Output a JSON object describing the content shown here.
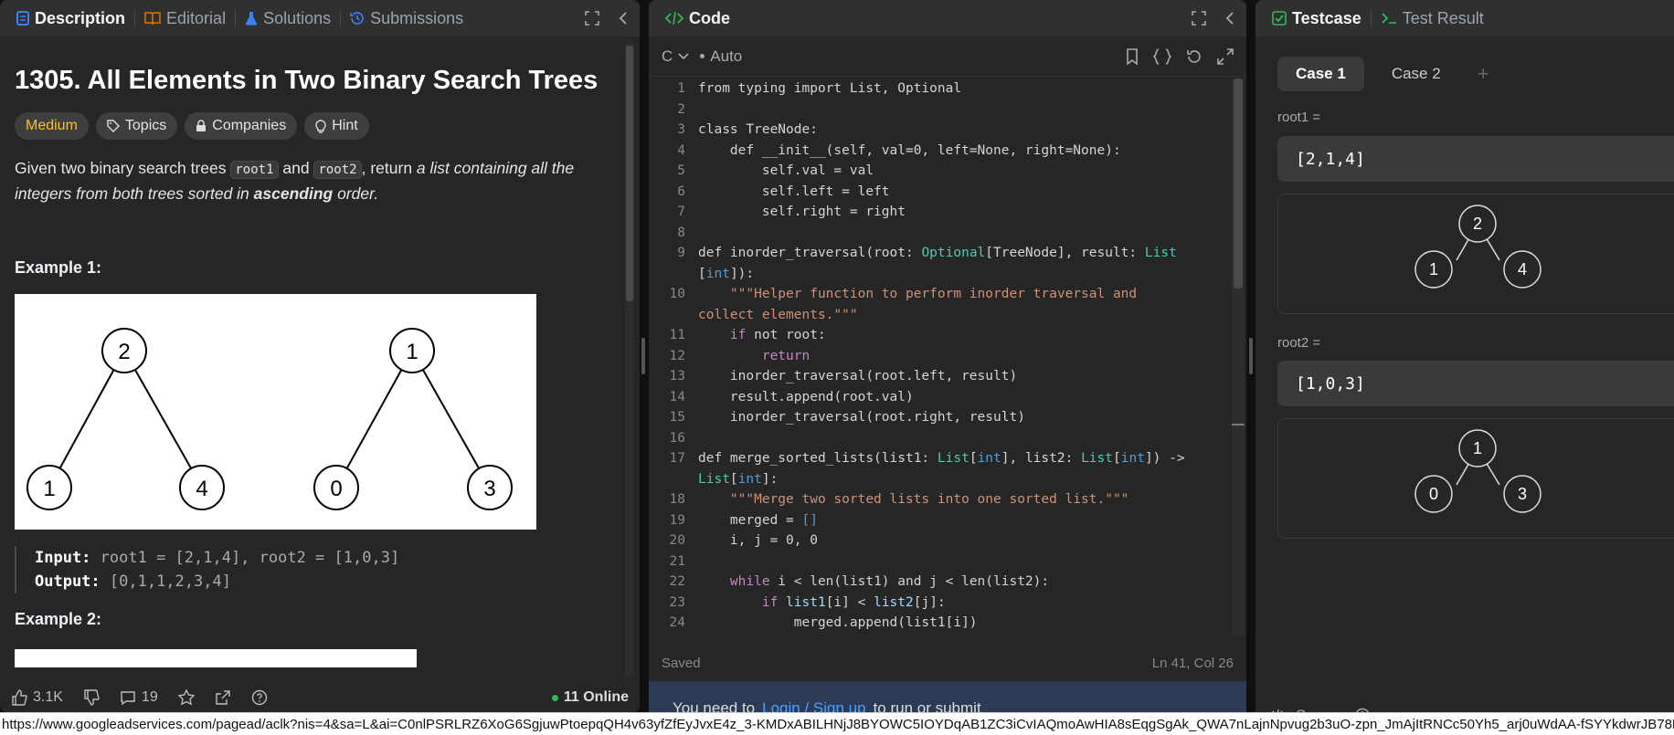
{
  "desc": {
    "tabs": [
      {
        "label": "Description"
      },
      {
        "label": "Editorial"
      },
      {
        "label": "Solutions"
      },
      {
        "label": "Submissions"
      }
    ],
    "title": "1305. All Elements in Two Binary Search Trees",
    "chips": {
      "difficulty": "Medium",
      "topics": "Topics",
      "companies": "Companies",
      "hint": "Hint"
    },
    "text": {
      "p1": "Given two binary search trees ",
      "root1": "root1",
      "and": " and ",
      "root2": "root2",
      "p2": ", return ",
      "italic1": "a list containing all the integers from both trees sorted in ",
      "bold": "ascending",
      "italic2": " order."
    },
    "example1": {
      "heading": "Example 1:",
      "tree1": {
        "root": "2",
        "left": "1",
        "right": "4"
      },
      "tree2": {
        "root": "1",
        "left": "0",
        "right": "3"
      },
      "input_label": "Input:",
      "input": " root1 = [2,1,4], root2 = [1,0,3]",
      "output_label": "Output:",
      "output": " [0,1,1,2,3,4]"
    },
    "example2": {
      "heading": "Example 2:"
    },
    "footer": {
      "likes": "3.1K",
      "comments": "19",
      "online": "11 Online"
    }
  },
  "code": {
    "tab": "Code",
    "language": "C",
    "mode": "Auto",
    "lines": [
      [
        {
          "t": "from typing import List, Optional",
          "c": "#d4d4d4"
        }
      ],
      [],
      [
        {
          "t": "class TreeNode:",
          "c": "#d4d4d4"
        }
      ],
      [
        {
          "t": "    def __init__(self, val=0, left=None, right=None):",
          "c": "#d4d4d4"
        }
      ],
      [
        {
          "t": "        self.val = val",
          "c": "#d4d4d4"
        }
      ],
      [
        {
          "t": "        self.left = left",
          "c": "#d4d4d4"
        }
      ],
      [
        {
          "t": "        self.right = right",
          "c": "#d4d4d4"
        }
      ],
      [],
      [
        {
          "t": "def inorder_traversal(root: ",
          "c": "#d4d4d4"
        },
        {
          "t": "Optional",
          "c": "#4ec9b0"
        },
        {
          "t": "[TreeNode], result: ",
          "c": "#d4d4d4"
        },
        {
          "t": "List",
          "c": "#4ec9b0"
        }
      ],
      [
        {
          "t": "[",
          "c": "#d4d4d4"
        },
        {
          "t": "int",
          "c": "#569cd6"
        },
        {
          "t": "]):",
          "c": "#d4d4d4"
        }
      ],
      [
        {
          "t": "    \"\"\"Helper function to perform inorder traversal and",
          "c": "#ce9178"
        }
      ],
      [
        {
          "t": "collect elements.\"\"\"",
          "c": "#ce9178"
        }
      ],
      [
        {
          "t": "    ",
          "c": "#d4d4d4"
        },
        {
          "t": "if",
          "c": "#c586c0"
        },
        {
          "t": " not root:",
          "c": "#d4d4d4"
        }
      ],
      [
        {
          "t": "        ",
          "c": "#d4d4d4"
        },
        {
          "t": "return",
          "c": "#c586c0"
        }
      ],
      [
        {
          "t": "    inorder_traversal(root.left, result)",
          "c": "#d4d4d4"
        }
      ],
      [
        {
          "t": "    result.append(root.val)",
          "c": "#d4d4d4"
        }
      ],
      [
        {
          "t": "    inorder_traversal(root.right, result)",
          "c": "#d4d4d4"
        }
      ],
      [],
      [
        {
          "t": "def merge_sorted_lists(list1: ",
          "c": "#d4d4d4"
        },
        {
          "t": "List",
          "c": "#4ec9b0"
        },
        {
          "t": "[",
          "c": "#d4d4d4"
        },
        {
          "t": "int",
          "c": "#569cd6"
        },
        {
          "t": "], list2: ",
          "c": "#d4d4d4"
        },
        {
          "t": "List",
          "c": "#4ec9b0"
        },
        {
          "t": "[",
          "c": "#d4d4d4"
        },
        {
          "t": "int",
          "c": "#569cd6"
        },
        {
          "t": "]) ->",
          "c": "#d4d4d4"
        }
      ],
      [
        {
          "t": "List",
          "c": "#4ec9b0"
        },
        {
          "t": "[",
          "c": "#d4d4d4"
        },
        {
          "t": "int",
          "c": "#569cd6"
        },
        {
          "t": "]:",
          "c": "#d4d4d4"
        }
      ],
      [
        {
          "t": "    \"\"\"Merge two sorted lists into one sorted list.\"\"\"",
          "c": "#ce9178"
        }
      ],
      [
        {
          "t": "    merged = ",
          "c": "#d4d4d4"
        },
        {
          "t": "[]",
          "c": "#569cd6"
        }
      ],
      [
        {
          "t": "    i, j = 0, 0",
          "c": "#d4d4d4"
        }
      ],
      [],
      [
        {
          "t": "    ",
          "c": "#d4d4d4"
        },
        {
          "t": "while",
          "c": "#c586c0"
        },
        {
          "t": " i < len(list1) and j < len(list2):",
          "c": "#d4d4d4"
        }
      ],
      [
        {
          "t": "        ",
          "c": "#d4d4d4"
        },
        {
          "t": "if",
          "c": "#c586c0"
        },
        {
          "t": " ",
          "c": "#d4d4d4"
        },
        {
          "t": "list1",
          "c": "#9cdcfe"
        },
        {
          "t": "[i] < ",
          "c": "#d4d4d4"
        },
        {
          "t": "list2",
          "c": "#9cdcfe"
        },
        {
          "t": "[j]:",
          "c": "#d4d4d4"
        }
      ],
      [
        {
          "t": "            merged.append(list1[i])",
          "c": "#d4d4d4"
        }
      ]
    ],
    "line_numbers": [
      "1",
      "2",
      "3",
      "4",
      "5",
      "6",
      "7",
      "8",
      "9",
      "",
      "10",
      "",
      "11",
      "12",
      "13",
      "14",
      "15",
      "16",
      "17",
      "",
      "18",
      "19",
      "20",
      "21",
      "22",
      "23",
      "24"
    ],
    "status_saved": "Saved",
    "status_pos": "Ln 41, Col 26",
    "login": {
      "prefix": "You need to",
      "link": "Login / Sign up",
      "suffix": "to run or submit"
    }
  },
  "test": {
    "tab_testcase": "Testcase",
    "tab_result": "Test Result",
    "cases": [
      "Case 1",
      "Case 2"
    ],
    "plus": "+",
    "root1_label": "root1 =",
    "root1_value": "[2,1,4]",
    "root1_tree": {
      "root": "2",
      "left": "1",
      "right": "4"
    },
    "root2_label": "root2 =",
    "root2_value": "[1,0,3]",
    "root2_tree": {
      "root": "1",
      "left": "0",
      "right": "3"
    },
    "footer_source": "Source"
  },
  "status_url": "https://www.googleadservices.com/pagead/aclk?nis=4&sa=L&ai=C0nlPSRLRZ6XoG6SgjuwPtoepqQH4v63yfZfEyJvxE4z_3-KMDxABILHNjJ8BYOWC5IOYDqAB1ZC3iCvIAQmoAwHIA8sEqgSgAk_QWA7nLajnNpvug2b3uO-zpn_JmAjItRNCc50Yh5_arj0uWdAA-fSYYkdwrJB78DLKtXOLuOn"
}
